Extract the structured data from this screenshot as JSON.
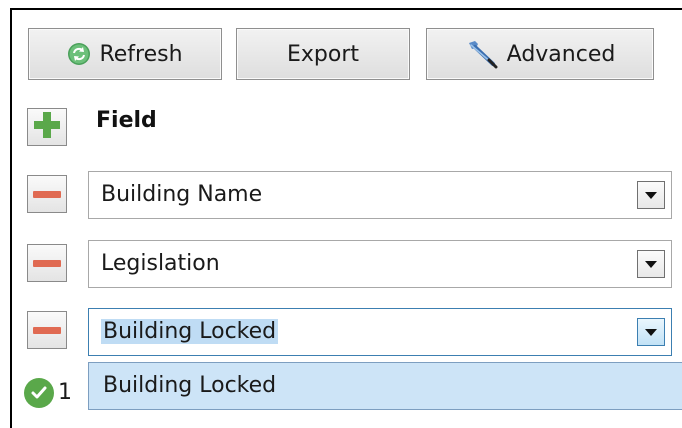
{
  "toolbar": {
    "refresh_label": "Refresh",
    "export_label": "Export",
    "advanced_label": "Advanced"
  },
  "fields": {
    "header": "Field",
    "rows": [
      {
        "value": "Building Name"
      },
      {
        "value": "Legislation"
      },
      {
        "value": "Building Locked"
      }
    ]
  },
  "dropdown": {
    "options": [
      "Building Locked"
    ]
  },
  "status": {
    "count_text": "1"
  },
  "icons": {
    "refresh": "refresh-icon",
    "advanced": "wrench-icon",
    "add": "plus-icon",
    "remove": "minus-icon",
    "dropdown": "chevron-down-icon",
    "status": "check-circle-icon"
  },
  "colors": {
    "plus_green": "#5aa84a",
    "minus_red": "#e06a52",
    "selection_blue": "#cde4f7",
    "focus_border": "#3c7fb1"
  }
}
